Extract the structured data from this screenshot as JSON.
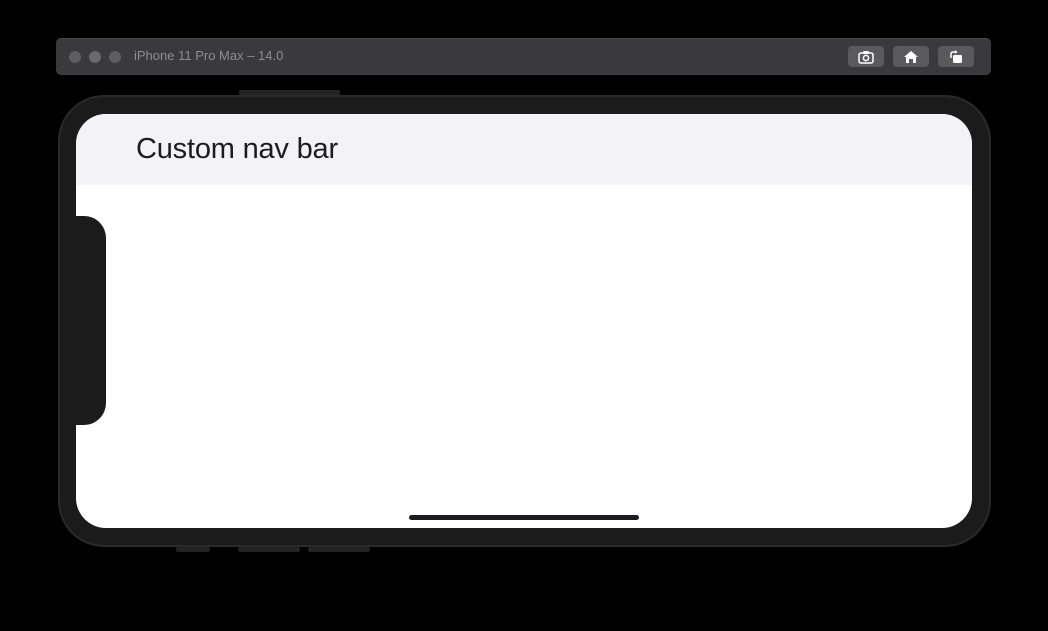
{
  "window": {
    "title": "iPhone 11 Pro Max – 14.0",
    "toolbar_buttons": [
      {
        "icon": "screenshot-icon"
      },
      {
        "icon": "home-icon"
      },
      {
        "icon": "rotate-icon"
      }
    ]
  },
  "screen": {
    "nav_bar": {
      "title": "Custom nav bar",
      "background": "#f2f2f7"
    },
    "content_background": "#ffffff"
  },
  "colors": {
    "page_background": "#000000",
    "titlebar": "#3a3a3c",
    "device_frame": "#1b1b1c",
    "home_indicator": "#1c1c1e"
  }
}
